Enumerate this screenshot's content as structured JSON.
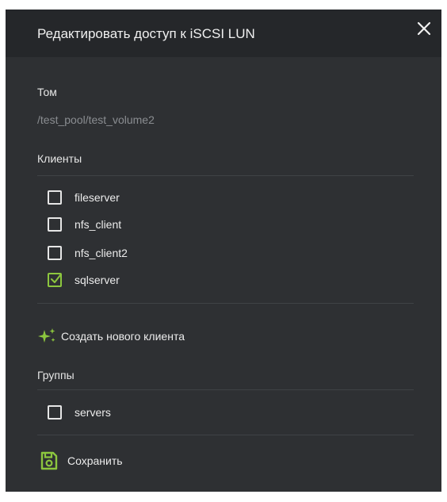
{
  "dialog": {
    "title": "Редактировать доступ к iSCSI LUN",
    "close_icon": "close-icon"
  },
  "volume": {
    "label": "Том",
    "value": "/test_pool/test_volume2"
  },
  "clients": {
    "label": "Клиенты",
    "items": [
      {
        "label": "fileserver",
        "checked": false
      },
      {
        "label": "nfs_client",
        "checked": false
      },
      {
        "label": "nfs_client2",
        "checked": false
      },
      {
        "label": "sqlserver",
        "checked": true
      }
    ],
    "create_label": "Создать нового клиента",
    "create_icon": "sparkle-icon"
  },
  "groups": {
    "label": "Группы",
    "items": [
      {
        "label": "servers",
        "checked": false
      }
    ]
  },
  "save": {
    "label": "Сохранить",
    "icon": "floppy-disk-icon"
  },
  "colors": {
    "accent": "#8cc63e",
    "dialog_bg": "#2e3033",
    "header_bg": "#25272a",
    "muted_text": "#8a8d91"
  }
}
